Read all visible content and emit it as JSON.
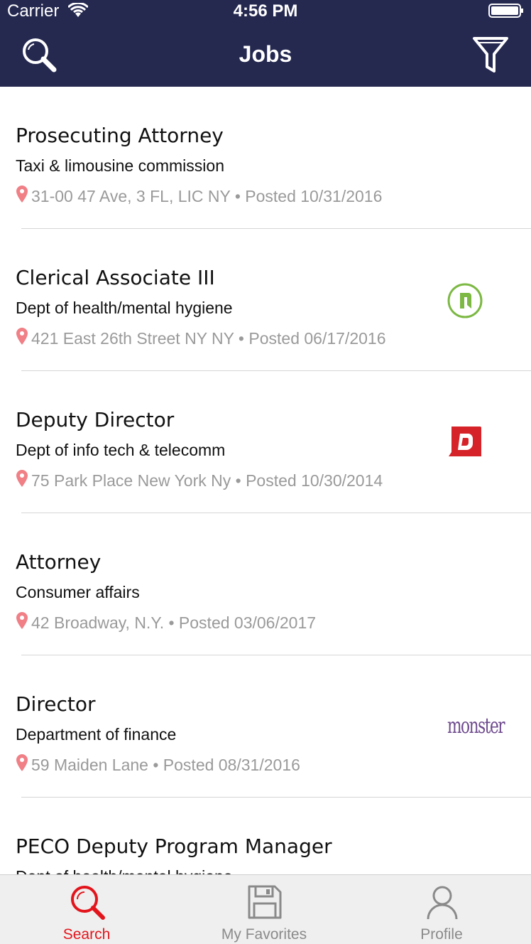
{
  "status_bar": {
    "carrier": "Carrier",
    "time": "4:56 PM"
  },
  "header": {
    "title": "Jobs",
    "search_icon": "search-icon",
    "filter_icon": "filter-icon"
  },
  "jobs": [
    {
      "title": "Prosecuting Attorney",
      "department": "Taxi & limousine commission",
      "meta": "31-00 47 Ave, 3 FL, LIC NY • Posted 10/31/2016",
      "logo": ""
    },
    {
      "title": "Clerical Associate III",
      "department": "Dept of health/mental hygiene",
      "meta": "421 East 26th Street NY NY • Posted 06/17/2016",
      "logo": "glassdoor"
    },
    {
      "title": "Deputy Director",
      "department": "Dept of info tech & telecomm",
      "meta": "75 Park Place New York Ny • Posted 10/30/2014",
      "logo": "dice"
    },
    {
      "title": "Attorney",
      "department": "Consumer affairs",
      "meta": "42 Broadway, N.Y. • Posted 03/06/2017",
      "logo": ""
    },
    {
      "title": "Director",
      "department": "Department of finance",
      "meta": "59 Maiden Lane • Posted 08/31/2016",
      "logo": "monster",
      "logo_text": "monster"
    },
    {
      "title": "PECO Deputy Program Manager",
      "department": "Dept of health/mental hygiene",
      "meta": "",
      "logo": ""
    }
  ],
  "tabs": [
    {
      "label": "Search",
      "icon": "search-icon",
      "active": true
    },
    {
      "label": "My Favorites",
      "icon": "floppy-disk-icon",
      "active": false
    },
    {
      "label": "Profile",
      "icon": "person-icon",
      "active": false
    }
  ],
  "colors": {
    "header_bg": "#252950",
    "accent": "#e3151c",
    "pin": "#f07f86",
    "muted_text": "#9a9a9a"
  }
}
